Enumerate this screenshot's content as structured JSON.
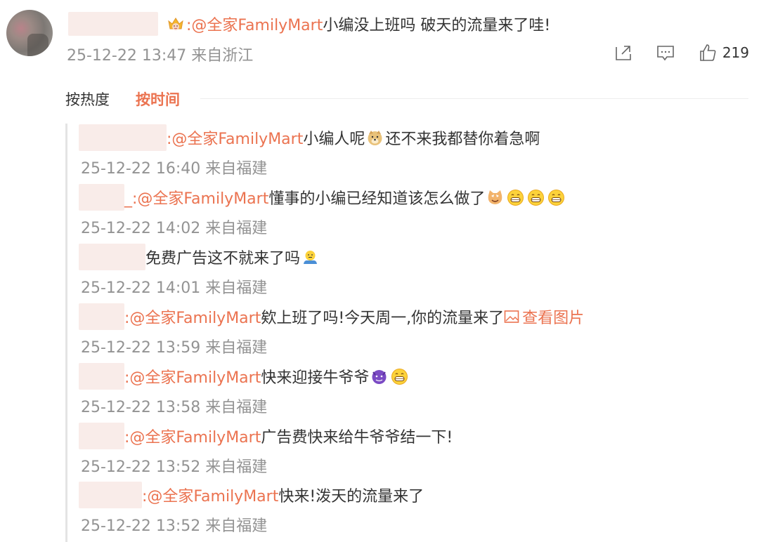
{
  "comment": {
    "mention": ":@全家FamilyMart",
    "text": " 小编没上班吗 破天的流量来了哇!",
    "meta": "25-12-22 13:47 来自浙江",
    "like_count": "219",
    "icons": {
      "badge": "crown-icon",
      "share": "share-icon",
      "comment": "comment-icon",
      "like": "thumbs-up-icon"
    }
  },
  "sort": {
    "hot": "按热度",
    "time": "按时间"
  },
  "replies": [
    {
      "mention": ":@全家FamilyMart",
      "text_before": " 小编人呢",
      "emojis_mid": [
        "doge"
      ],
      "text_after": "还不来我都替你着急啊",
      "meta": "25-12-22 16:40 来自福建"
    },
    {
      "mention": "_:@全家FamilyMart",
      "text_before": " 懂事的小编已经知道该怎么做了",
      "emojis_end": [
        "cat",
        "grin",
        "grin",
        "grin"
      ],
      "meta": "25-12-22 14:02 来自福建"
    },
    {
      "mention": "",
      "text_before": "免费广告这不就来了吗",
      "emojis_end": [
        "shrug"
      ],
      "meta": "25-12-22 14:01 来自福建"
    },
    {
      "mention": ":@全家FamilyMart",
      "text_before": " 欸上班了吗!今天周一,你的流量来了 ",
      "link": "查看图片",
      "meta": "25-12-22 13:59 来自福建"
    },
    {
      "mention": ":@全家FamilyMart",
      "text_before": "  快来迎接牛爷爷",
      "emojis_end": [
        "devil",
        "grin"
      ],
      "meta": "25-12-22 13:58 来自福建"
    },
    {
      "mention": ":@全家FamilyMart",
      "text_before": " 广告费快来给牛爷爷结一下!",
      "meta": "25-12-22 13:52 来自福建"
    },
    {
      "mention": ":@全家FamilyMart",
      "text_before": " 快来!泼天的流量来了",
      "meta": "25-12-22 13:52 来自福建"
    }
  ],
  "colors": {
    "accent": "#eb7350",
    "meta": "#939393",
    "text": "#333333"
  }
}
